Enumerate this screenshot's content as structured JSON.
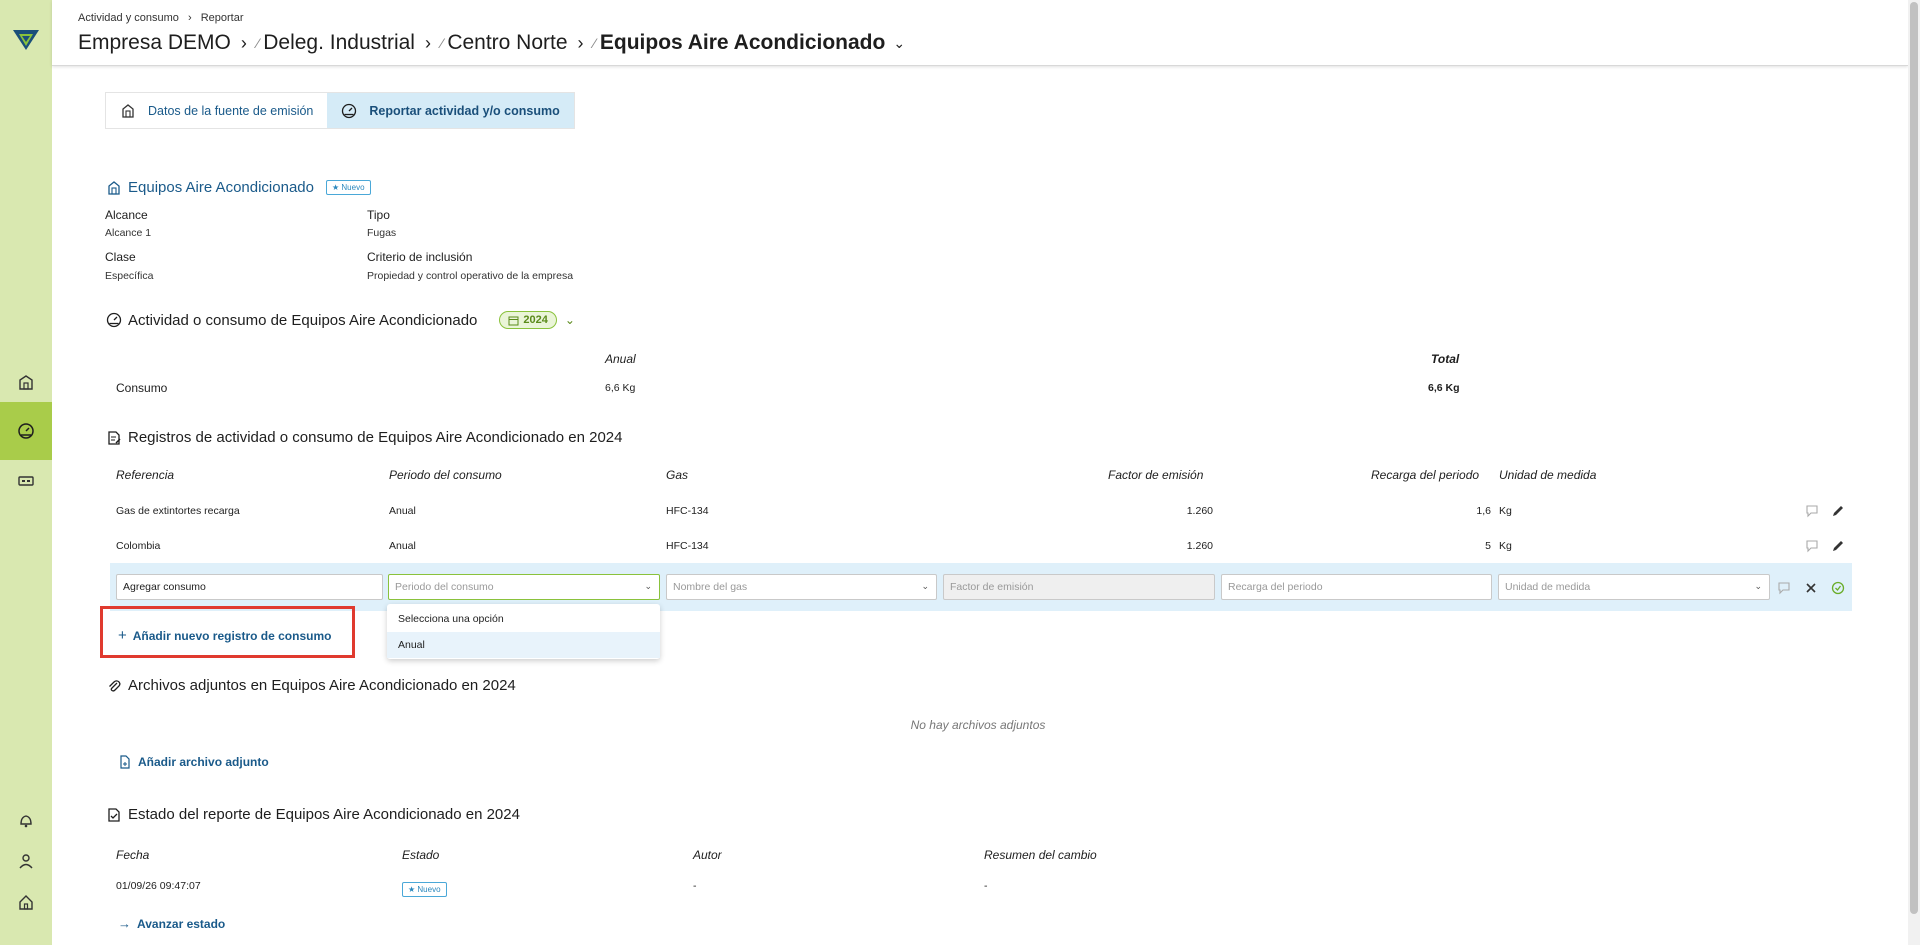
{
  "header": {
    "crumb_small": [
      "Actividad y consumo",
      "Reportar"
    ],
    "crumb_big": [
      "Empresa DEMO",
      "Deleg. Industrial",
      "Centro Norte"
    ],
    "current": "Equipos Aire Acondicionado"
  },
  "tabs": [
    {
      "label": "Datos de la fuente de emisión",
      "icon": "building-icon"
    },
    {
      "label": "Reportar actividad y/o consumo",
      "icon": "gauge-icon",
      "active": true
    }
  ],
  "source": {
    "title": "Equipos Aire Acondicionado",
    "badge": "Nuevo",
    "fields": {
      "alcance_label": "Alcance",
      "alcance_value": "Alcance 1",
      "tipo_label": "Tipo",
      "tipo_value": "Fugas",
      "clase_label": "Clase",
      "clase_value": "Específica",
      "criterio_label": "Criterio de inclusión",
      "criterio_value": "Propiedad y control operativo de la empresa"
    }
  },
  "activity": {
    "title": "Actividad o consumo de Equipos Aire Acondicionado",
    "year": "2024",
    "col_anual": "Anual",
    "col_total": "Total",
    "row_label": "Consumo",
    "anual_value": "6,6 Kg",
    "total_value": "6,6 Kg"
  },
  "records": {
    "title": "Registros de actividad o consumo de Equipos Aire Acondicionado en 2024",
    "headers": [
      "Referencia",
      "Periodo del consumo",
      "Gas",
      "Factor de emisión",
      "Recarga del periodo",
      "Unidad de medida"
    ],
    "rows": [
      {
        "ref": "Gas de extintortes recarga",
        "periodo": "Anual",
        "gas": "HFC-134",
        "factor": "1.260",
        "recarga": "1,6",
        "unidad": "Kg"
      },
      {
        "ref": "Colombia",
        "periodo": "Anual",
        "gas": "HFC-134",
        "factor": "1.260",
        "recarga": "5",
        "unidad": "Kg"
      }
    ],
    "edit_row": {
      "ref_value": "Agregar consumo",
      "periodo_placeholder": "Periodo del consumo",
      "gas_placeholder": "Nombre del gas",
      "factor_placeholder": "Factor de emisión",
      "recarga_placeholder": "Recarga del periodo",
      "unidad_placeholder": "Unidad de medida"
    },
    "dropdown_options": [
      "Selecciona una opción",
      "Anual"
    ],
    "add_button": "Añadir nuevo registro de consumo"
  },
  "attachments": {
    "title": "Archivos adjuntos en Equipos Aire Acondicionado en 2024",
    "empty": "No hay archivos adjuntos",
    "add_button": "Añadir archivo adjunto"
  },
  "status": {
    "title": "Estado del reporte de Equipos Aire Acondicionado en 2024",
    "headers": [
      "Fecha",
      "Estado",
      "Autor",
      "Resumen del cambio"
    ],
    "row": {
      "fecha": "01/09/26 09:47:07",
      "estado": "Nuevo",
      "autor": "-",
      "resumen": "-"
    },
    "advance_button": "Avanzar estado"
  },
  "colors": {
    "sidebar": "#d9e8b0",
    "accent_green": "#a9cc4a",
    "link_blue": "#1a5a8a",
    "highlight": "#e03a2f"
  }
}
